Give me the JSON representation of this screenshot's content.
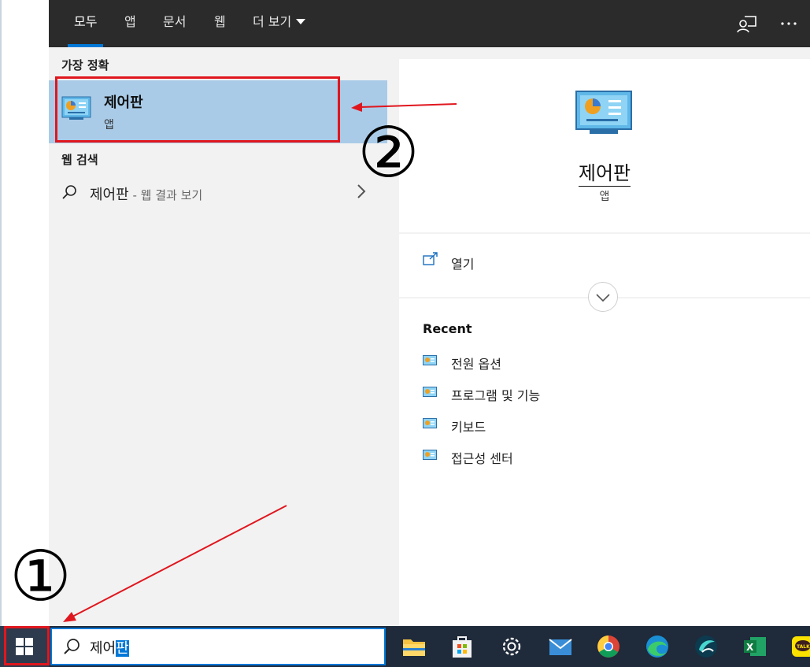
{
  "tabs": [
    {
      "label": "모두",
      "active": true
    },
    {
      "label": "앱"
    },
    {
      "label": "문서"
    },
    {
      "label": "웹"
    },
    {
      "label": "더 보기"
    }
  ],
  "topbar_icons": [
    "feedback-icon",
    "more-options-icon"
  ],
  "results": {
    "best_match_header": "가장 정확",
    "best_match": {
      "title": "제어판",
      "subtitle": "앱",
      "icon": "control-panel-icon"
    },
    "web_header": "웹 검색",
    "web_item": {
      "query": "제어판",
      "hint": " - 웹 결과 보기"
    }
  },
  "preview": {
    "title": "제어판",
    "subtitle": "앱",
    "open_label": "열기",
    "recent_header": "Recent",
    "recent_items": [
      "전원 옵션",
      "프로그램 및 기능",
      "키보드",
      "접근성 센터"
    ]
  },
  "annotations": {
    "step1": "①",
    "step2": "②"
  },
  "search": {
    "value_plain": "제어",
    "value_selected": "판"
  },
  "taskbar_apps": [
    "file-explorer-icon",
    "store-icon",
    "settings-icon",
    "mail-icon",
    "chrome-icon",
    "edge-icon",
    "app-swift-icon",
    "excel-icon",
    "kakaotalk-icon"
  ],
  "colors": {
    "accent": "#0078d7",
    "highlight": "#a9cbe8",
    "annotation": "#e0161e"
  }
}
